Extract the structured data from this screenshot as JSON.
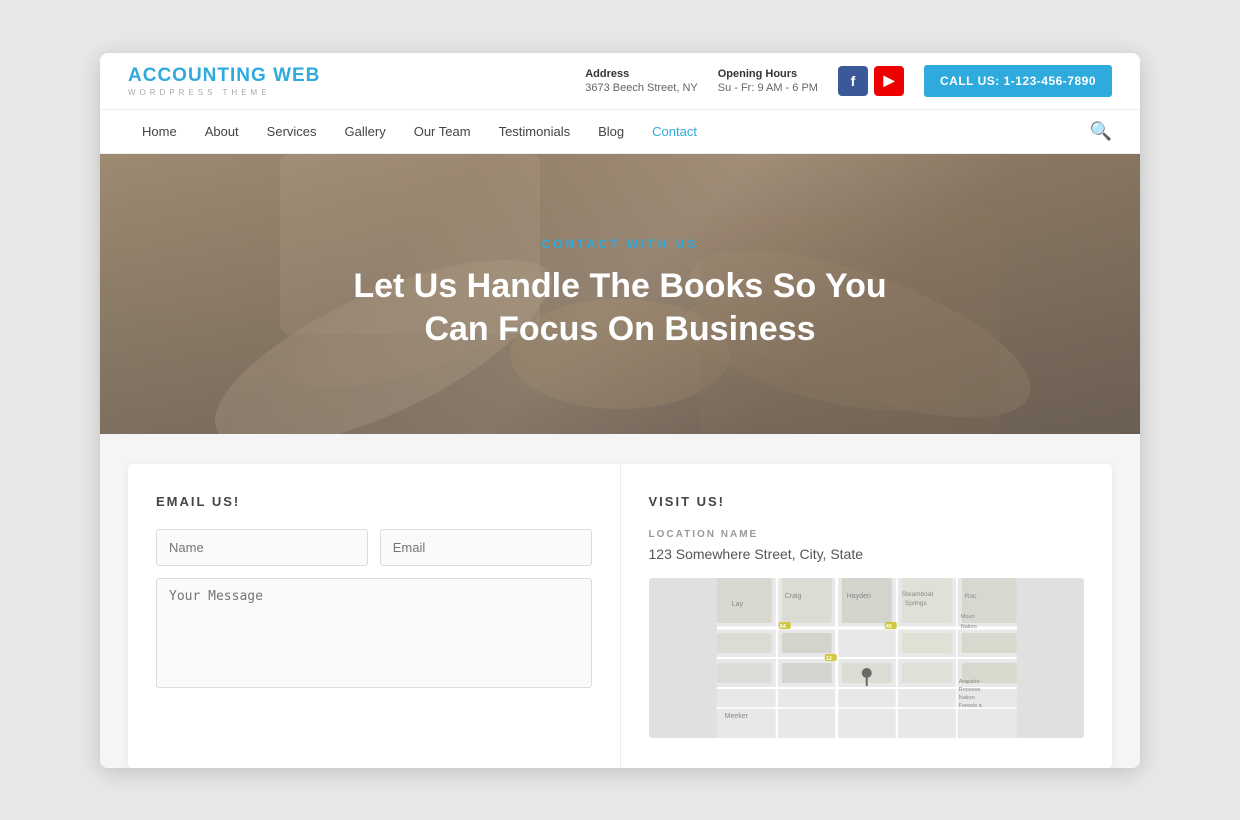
{
  "logo": {
    "main": "ACCOUNTING ",
    "accent": "WEB",
    "sub": "WORDPRESS THEME"
  },
  "header": {
    "address_label": "Address",
    "address_value": "3673 Beech Street, NY",
    "hours_label": "Opening Hours",
    "hours_value": "Su - Fr: 9 AM - 6 PM",
    "call_button": "CALL US: 1-123-456-7890"
  },
  "nav": {
    "links": [
      "Home",
      "About",
      "Services",
      "Gallery",
      "Our Team",
      "Testimonials",
      "Blog",
      "Contact"
    ]
  },
  "hero": {
    "subtitle": "CONTACT WITH US",
    "title": "Let Us Handle The Books So You Can Focus On Business"
  },
  "email_section": {
    "heading": "EMAIL US!",
    "name_placeholder": "Name",
    "email_placeholder": "Email",
    "message_placeholder": "Your Message"
  },
  "visit_section": {
    "heading": "VISIT US!",
    "location_label": "LOCATION NAME",
    "address": "123 Somewhere Street, City, State"
  },
  "social": {
    "facebook_label": "f",
    "youtube_label": "▶"
  }
}
